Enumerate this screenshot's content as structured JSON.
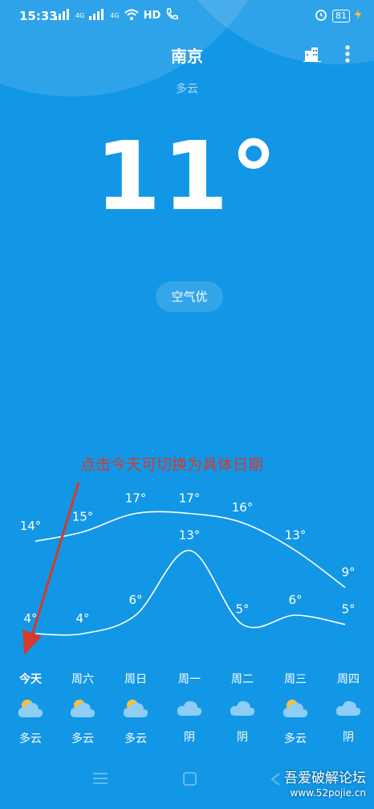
{
  "status": {
    "time": "15:33",
    "net1": "4G",
    "net2": "4G",
    "hd": "HD",
    "battery": "81"
  },
  "header": {
    "city": "南京",
    "condition": "多云"
  },
  "current": {
    "temperature": "11°",
    "aqi": "空气优"
  },
  "annotation": "点击今天可切换为具体日期",
  "chart_data": {
    "type": "line",
    "categories": [
      "今天",
      "周六",
      "周日",
      "周一",
      "周二",
      "周三",
      "周四"
    ],
    "series": [
      {
        "values": [
          14,
          15,
          17,
          17,
          16,
          13,
          9
        ]
      },
      {
        "values": [
          4,
          4,
          6,
          13,
          5,
          6,
          5
        ]
      }
    ],
    "high_labels": [
      "14°",
      "15°",
      "17°",
      "17°",
      "16°",
      "13°",
      "9°"
    ],
    "low_labels": [
      "4°",
      "4°",
      "6°",
      "13°",
      "5°",
      "6°",
      "5°"
    ]
  },
  "forecast": [
    {
      "day": "今天",
      "icon": "partly-cloudy-icon",
      "cond": "多云"
    },
    {
      "day": "周六",
      "icon": "partly-cloudy-icon",
      "cond": "多云"
    },
    {
      "day": "周日",
      "icon": "partly-cloudy-icon",
      "cond": "多云"
    },
    {
      "day": "周一",
      "icon": "cloud-icon",
      "cond": "阴"
    },
    {
      "day": "周二",
      "icon": "cloud-icon",
      "cond": "阴"
    },
    {
      "day": "周三",
      "icon": "partly-cloudy-icon",
      "cond": "多云"
    },
    {
      "day": "周四",
      "icon": "cloud-icon",
      "cond": "阴"
    }
  ],
  "watermark": {
    "title": "吾爱破解论坛",
    "url": "www.52pojie.cn"
  },
  "colors": {
    "background": "#1297e6",
    "annotation": "#d23b2d",
    "sun": "#f5c13b",
    "cloud": "#8ecdf5"
  }
}
